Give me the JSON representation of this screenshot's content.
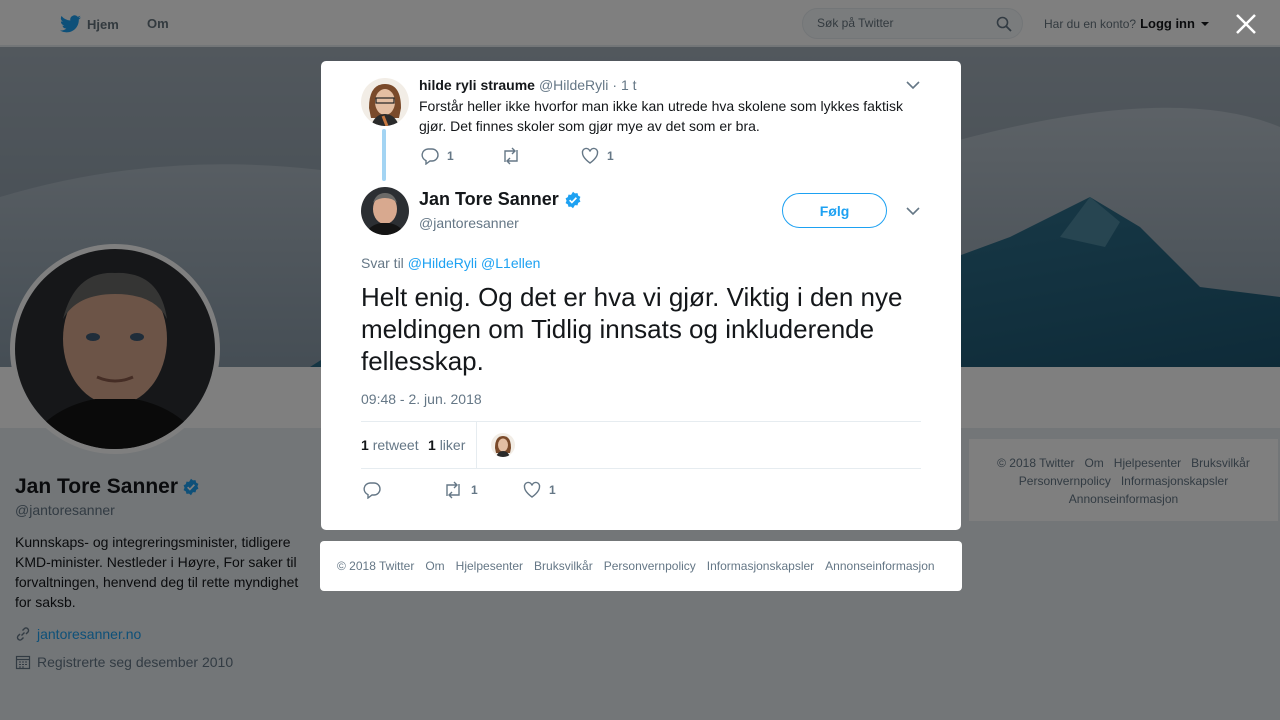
{
  "nav": {
    "home_label": "Hjem",
    "about_label": "Om",
    "search_placeholder": "Søk på Twitter",
    "account_question": "Har du en konto?",
    "login_label": "Logg inn"
  },
  "profile": {
    "name": "Jan Tore Sanner",
    "handle": "@jantoresanner",
    "bio": "Kunnskaps- og integreringsminister, tidligere KMD-minister. Nestleder i Høyre, For saker til forvaltningen, henvend deg til rette myndighet for saksb.",
    "website": "jantoresanner.no",
    "joined": "Registrerte seg desember 2010"
  },
  "right_footer": {
    "links": [
      "© 2018 Twitter",
      "Om",
      "Hjelpesenter",
      "Bruksvilkår",
      "Personvernpolicy",
      "Informasjonskapsler",
      "Annonseinformasjon"
    ]
  },
  "reply_tweet": {
    "name": "hilde ryli straume",
    "handle": "@HildeRyli",
    "time": "· 1 t",
    "text": "Forstår heller ikke hvorfor man ikke kan utrede hva  skolene som lykkes faktisk gjør. Det finnes skoler som gjør mye av det som er bra.",
    "replies": "1",
    "retweets": "",
    "likes": "1"
  },
  "main_tweet": {
    "name": "Jan Tore Sanner",
    "handle": "@jantoresanner",
    "follow_label": "Følg",
    "reply_to_label": "Svar til",
    "reply_to_users": [
      "@HildeRyli",
      "@L1ellen"
    ],
    "text": "Helt enig. Og det er hva vi gjør. Viktig i den nye meldingen om Tidlig innsats og inkluderende fellesskap.",
    "timestamp": "09:48 - 2. jun. 2018",
    "retweet_count": "1",
    "retweet_label": "retweet",
    "like_count": "1",
    "like_label": "liker",
    "action_retweets": "1",
    "action_likes": "1"
  },
  "modal_footer": {
    "links": [
      "© 2018 Twitter",
      "Om",
      "Hjelpesenter",
      "Bruksvilkår",
      "Personvernpolicy",
      "Informasjonskapsler",
      "Annonseinformasjon"
    ]
  },
  "colors": {
    "accent": "#1da1f2",
    "background": "#e6ecf0",
    "muted": "#657786"
  }
}
